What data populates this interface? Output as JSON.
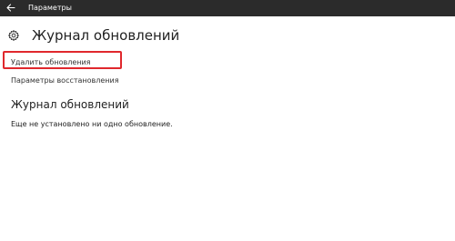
{
  "titlebar": {
    "title": "Параметры"
  },
  "page": {
    "title": "Журнал обновлений"
  },
  "links": {
    "uninstall_updates": "Удалить обновления",
    "recovery_options": "Параметры восстановления"
  },
  "history": {
    "section_title": "Журнал обновлений",
    "empty_message": "Еще не установлено ни одно обновление."
  },
  "icons": {
    "back": "back-arrow-icon",
    "page": "gear-icon"
  },
  "colors": {
    "titlebar_bg": "#2b2b2b",
    "highlight": "#e0282d"
  }
}
